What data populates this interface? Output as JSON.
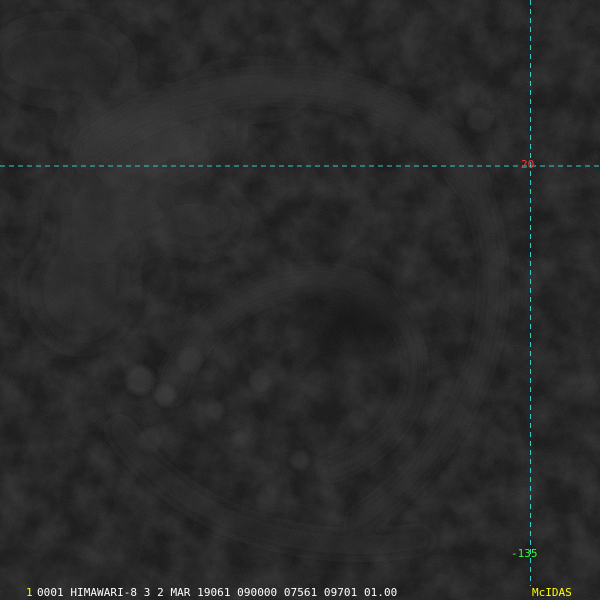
{
  "grid": {
    "line_color": "#33cccc",
    "latitude_label": "20",
    "latitude_label_color": "#ff3333",
    "longitude_label": "-135",
    "longitude_label_color": "#33ff33"
  },
  "status_bar": {
    "frame_number": "1",
    "frame_number_color": "#ffff00",
    "text": "0001 HIMAWARI-8   3   2 MAR 19061 090000 07561 09701 01.00",
    "text_color": "#ffffff",
    "brand": "McIDAS",
    "brand_color": "#ffff00"
  }
}
